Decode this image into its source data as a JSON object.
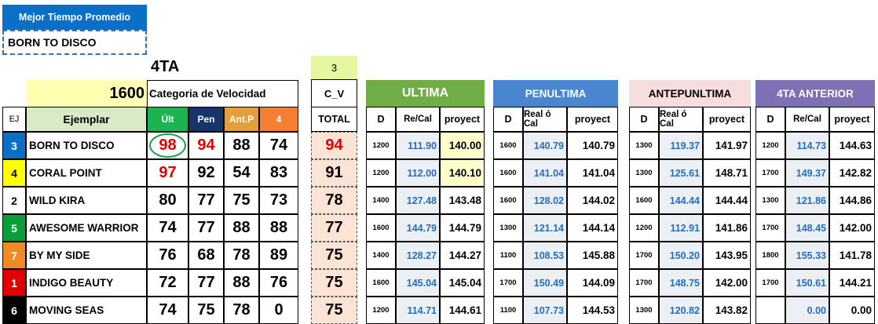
{
  "best": {
    "header": "Mejor Tiempo Promedio",
    "horse": "BORN TO DISCO"
  },
  "category": {
    "title": "4TA",
    "distance": "1600",
    "speed_label": "Categoria de Velocidad",
    "cv_value": "3",
    "cv_label": "C_V"
  },
  "columns": {
    "ej": "EJ",
    "ejemplar": "Ejemplar",
    "ult": "Últ",
    "pen": "Pen",
    "antp": "Ant.P",
    "four": "4",
    "total": "TOTAL"
  },
  "sections": [
    {
      "title": "ULTIMA",
      "bg": "#70ad47",
      "fg": "#ffffff",
      "d": "D",
      "rc": "Re/Cal",
      "proy": "proyect"
    },
    {
      "title": "PENULTIMA",
      "bg": "#4a86d0",
      "fg": "#ffffff",
      "d": "D",
      "rc": "Real ó Cal",
      "proy": "proyect"
    },
    {
      "title": "ANTEPUNLTIMA",
      "bg": "#f6dede",
      "fg": "#000000",
      "d": "D",
      "rc": "Real ó Cal",
      "proy": "proyect"
    },
    {
      "title": "4TA ANTERIOR",
      "bg": "#7f6fb5",
      "fg": "#ffffff",
      "d": "D",
      "rc": "Re/Cal",
      "proy": "proyect"
    }
  ],
  "colors": {
    "speed_ult": "#1db351",
    "speed_pen": "#16356b",
    "speed_ant": "#e39f3a",
    "speed_four": "#f47f32",
    "total_bg": "#fbe4d5",
    "ejemplar_bg": "#d9ebc6",
    "recal_bg": "#eceff3",
    "proy_hl": "#ffffcc"
  },
  "rows": [
    {
      "ej": "3",
      "ej_bg": "#0b6fc7",
      "ej_fg": "#ffffff",
      "name": "BORN TO DISCO",
      "ult": "98",
      "pen": "94",
      "antp": "88",
      "four": "74",
      "total": "94",
      "ult_red": true,
      "pen_red": true,
      "circle": true,
      "s": [
        [
          "1200",
          "111.90",
          "140.00",
          true
        ],
        [
          "1600",
          "140.79",
          "140.79",
          false
        ],
        [
          "1300",
          "119.37",
          "141.97",
          false
        ],
        [
          "1200",
          "114.73",
          "144.63",
          false
        ]
      ]
    },
    {
      "ej": "4",
      "ej_bg": "#ffff00",
      "ej_fg": "#000000",
      "name": "CORAL POINT",
      "ult": "97",
      "pen": "92",
      "antp": "54",
      "four": "83",
      "total": "91",
      "ult_red": true,
      "pen_red": false,
      "circle": false,
      "s": [
        [
          "1200",
          "112.00",
          "140.10",
          true
        ],
        [
          "1600",
          "141.04",
          "141.04",
          false
        ],
        [
          "1300",
          "125.61",
          "148.71",
          false
        ],
        [
          "1700",
          "149.37",
          "142.82",
          false
        ]
      ]
    },
    {
      "ej": "2",
      "ej_bg": "#ffffff",
      "ej_fg": "#000000",
      "name": "WILD KIRA",
      "ult": "80",
      "pen": "77",
      "antp": "75",
      "four": "73",
      "total": "78",
      "ult_red": false,
      "pen_red": false,
      "circle": false,
      "s": [
        [
          "1400",
          "127.48",
          "143.48",
          false
        ],
        [
          "1600",
          "128.02",
          "144.02",
          false
        ],
        [
          "1600",
          "144.44",
          "144.44",
          false
        ],
        [
          "1300",
          "121.86",
          "144.86",
          false
        ]
      ]
    },
    {
      "ej": "5",
      "ej_bg": "#0a9e3a",
      "ej_fg": "#ffffff",
      "name": "AWESOME WARRIOR",
      "ult": "74",
      "pen": "77",
      "antp": "88",
      "four": "88",
      "total": "77",
      "ult_red": false,
      "pen_red": false,
      "circle": false,
      "s": [
        [
          "1600",
          "144.79",
          "144.79",
          false
        ],
        [
          "1300",
          "121.14",
          "144.14",
          false
        ],
        [
          "1200",
          "112.91",
          "141.86",
          false
        ],
        [
          "1700",
          "148.45",
          "142.00",
          false
        ]
      ]
    },
    {
      "ej": "7",
      "ej_bg": "#f08a24",
      "ej_fg": "#ffffff",
      "name": "BY MY SIDE",
      "ult": "76",
      "pen": "68",
      "antp": "78",
      "four": "89",
      "total": "75",
      "ult_red": false,
      "pen_red": false,
      "circle": false,
      "s": [
        [
          "1400",
          "128.27",
          "144.27",
          false
        ],
        [
          "1100",
          "108.53",
          "145.88",
          false
        ],
        [
          "1700",
          "150.20",
          "143.95",
          false
        ],
        [
          "1800",
          "155.33",
          "141.78",
          false
        ]
      ]
    },
    {
      "ej": "1",
      "ej_bg": "#e00000",
      "ej_fg": "#ffffff",
      "name": "INDIGO BEAUTY",
      "ult": "72",
      "pen": "77",
      "antp": "88",
      "four": "76",
      "total": "75",
      "ult_red": false,
      "pen_red": false,
      "circle": false,
      "s": [
        [
          "1600",
          "145.04",
          "145.04",
          false
        ],
        [
          "1700",
          "150.49",
          "144.09",
          false
        ],
        [
          "1700",
          "148.75",
          "142.00",
          false
        ],
        [
          "1700",
          "150.61",
          "144.21",
          false
        ]
      ]
    },
    {
      "ej": "6",
      "ej_bg": "#000000",
      "ej_fg": "#ffffff",
      "name": "MOVING SEAS",
      "ult": "74",
      "pen": "75",
      "antp": "78",
      "four": "0",
      "total": "75",
      "ult_red": false,
      "pen_red": false,
      "circle": false,
      "s": [
        [
          "1200",
          "114.71",
          "144.61",
          false
        ],
        [
          "1100",
          "107.73",
          "144.53",
          false
        ],
        [
          "1300",
          "120.82",
          "143.82",
          false
        ],
        [
          "",
          "0.00",
          "0.00",
          false
        ]
      ]
    }
  ]
}
